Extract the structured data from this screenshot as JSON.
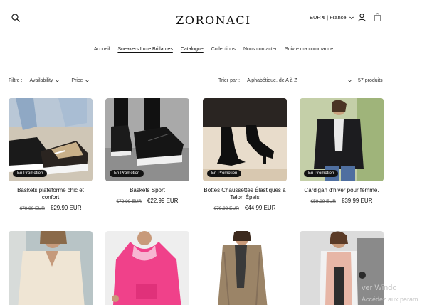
{
  "header": {
    "logo": "ZORONACI",
    "currency": "EUR € | France",
    "icons": {
      "search": "search-icon",
      "account": "user-icon",
      "cart": "bag-icon"
    }
  },
  "nav": [
    {
      "label": "Accueil",
      "active": false
    },
    {
      "label": "Sneakers Luxe Brillantes",
      "active": true
    },
    {
      "label": "Catalogue",
      "active": true
    },
    {
      "label": "Collections",
      "active": false
    },
    {
      "label": "Nous contacter",
      "active": false
    },
    {
      "label": "Suivre ma commande",
      "active": false
    }
  ],
  "filters": {
    "label": "Filtre :",
    "availability": "Availability",
    "price": "Price"
  },
  "sort": {
    "label": "Trier par :",
    "value": "Alphabétique, de A à Z"
  },
  "product_count": "57 produits",
  "products": [
    {
      "title": "Baskets plateforme chic et confort",
      "old_price": "€79,99 EUR",
      "price": "€29,99 EUR",
      "badge": "En Promotion"
    },
    {
      "title": "Baskets Sport",
      "old_price": "€79,99 EUR",
      "price": "€22,99 EUR",
      "badge": "En Promotion"
    },
    {
      "title": "Bottes Chaussettes Élastiques à Talon Épais",
      "old_price": "€79,99 EUR",
      "price": "€44,99 EUR",
      "badge": "En Promotion"
    },
    {
      "title": "Cardigan d'hiver pour femme.",
      "old_price": "€59,99 EUR",
      "price": "€39,99 EUR",
      "badge": "En Promotion"
    }
  ],
  "watermark": {
    "line1": "ver Windo",
    "line2": "Accédez aux param"
  },
  "colors": {
    "text": "#121212",
    "badge_bg": "#121212",
    "background": "#ffffff"
  }
}
